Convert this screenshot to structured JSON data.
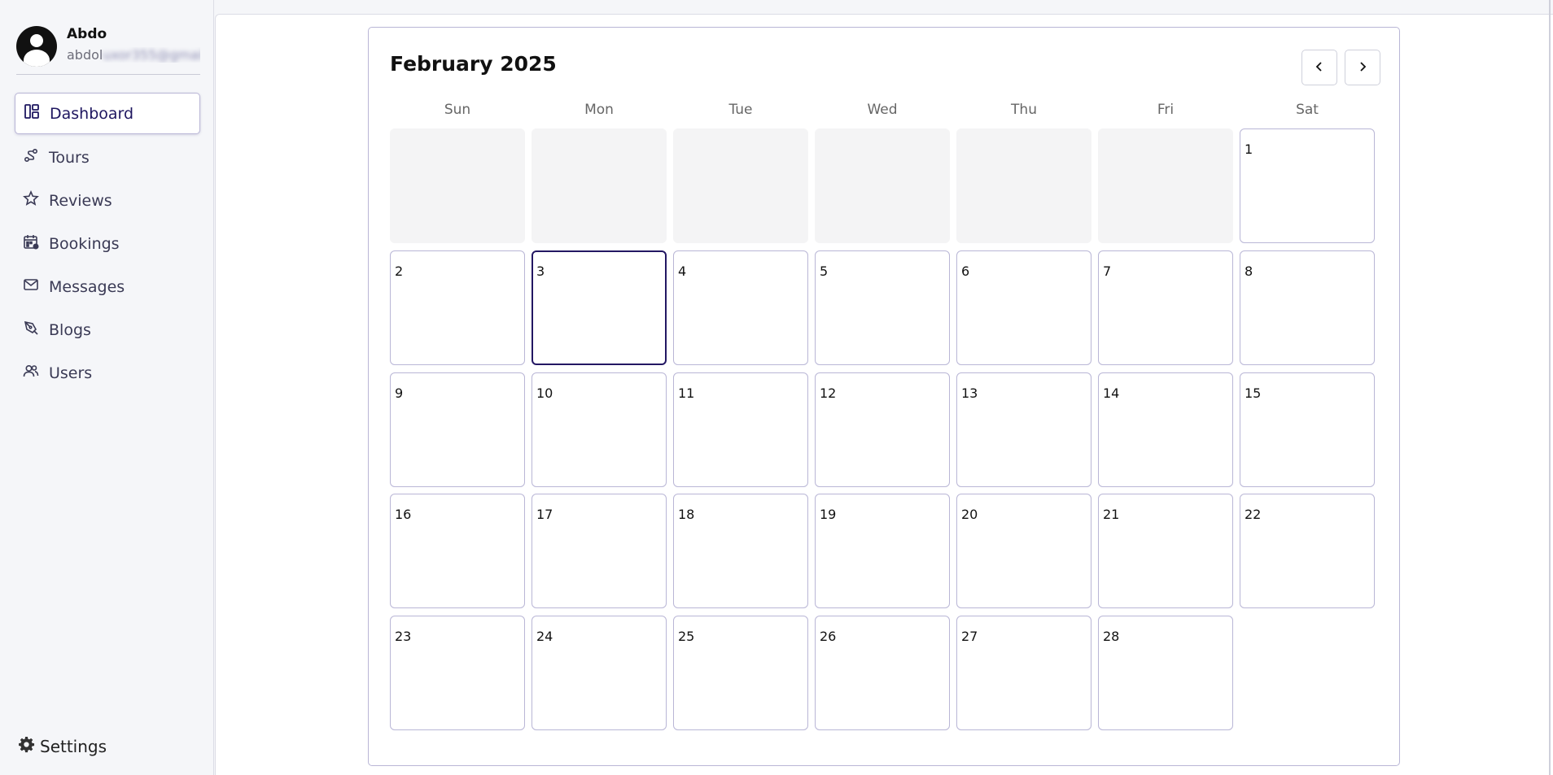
{
  "profile": {
    "name": "Abdo",
    "email_visible": "abdol",
    "email_blurred": "uxor355@gmail..."
  },
  "nav": [
    {
      "label": "Dashboard",
      "icon": "dashboard-icon",
      "active": true
    },
    {
      "label": "Tours",
      "icon": "route-icon"
    },
    {
      "label": "Reviews",
      "icon": "star-icon"
    },
    {
      "label": "Bookings",
      "icon": "calendar-check-icon"
    },
    {
      "label": "Messages",
      "icon": "mail-icon"
    },
    {
      "label": "Blogs",
      "icon": "pen-icon"
    },
    {
      "label": "Users",
      "icon": "users-icon"
    }
  ],
  "settings": {
    "label": "Settings",
    "icon": "gear-icon"
  },
  "calendar": {
    "title": "February 2025",
    "weekdays": [
      "Sun",
      "Mon",
      "Tue",
      "Wed",
      "Thu",
      "Fri",
      "Sat"
    ],
    "days": [
      1,
      2,
      3,
      4,
      5,
      6,
      7,
      8,
      9,
      10,
      11,
      12,
      13,
      14,
      15,
      16,
      17,
      18,
      19,
      20,
      21,
      22,
      23,
      24,
      25,
      26,
      27,
      28
    ],
    "leading_empty_days": 6,
    "selected_day": 3
  },
  "colors": {
    "accent": "#231763",
    "border": "#b9b6d6",
    "empty_cell": "#f4f4f5"
  }
}
